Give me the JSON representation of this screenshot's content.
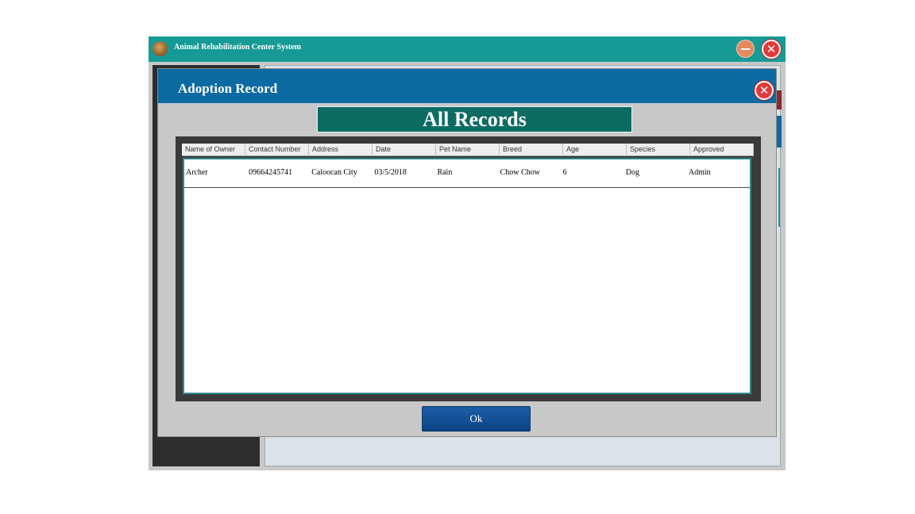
{
  "app": {
    "title": "Animal Rehabilitation Center System",
    "logo_icon": "paw-logo-icon",
    "minimize_icon": "minimize-icon",
    "close_icon": "close-icon",
    "close_glyph": "✕"
  },
  "dialog": {
    "title": "Adoption Record",
    "close_glyph": "✕",
    "banner": "All Records",
    "ok_label": "Ok"
  },
  "table": {
    "columns": [
      "Name of Owner",
      "Contact Number",
      "Address",
      "Date",
      "Pet Name",
      "Breed",
      "Age",
      "Species",
      "Approved"
    ],
    "rows": [
      [
        "Archer",
        "09664245741",
        "Caloocan City",
        "03/5/2018",
        "Rain",
        "Chow Chow",
        "6",
        "Dog",
        "Admin"
      ]
    ]
  },
  "colors": {
    "titlebar": "#169a96",
    "dialog_header": "#0c6aa3",
    "banner": "#0c6b63",
    "ok_button": "#0b4384"
  }
}
